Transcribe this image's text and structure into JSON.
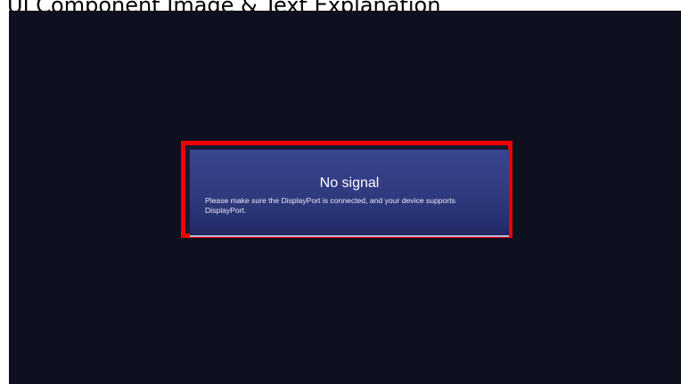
{
  "caption": "UI Component Image & Text Explanation",
  "screen": {
    "background_color": "#0e0f1f"
  },
  "highlight": {
    "color": "#ee0000"
  },
  "dialog": {
    "title": "No signal",
    "message": "Please make sure the DisplayPort is connected, and your device supports DisplayPort."
  }
}
